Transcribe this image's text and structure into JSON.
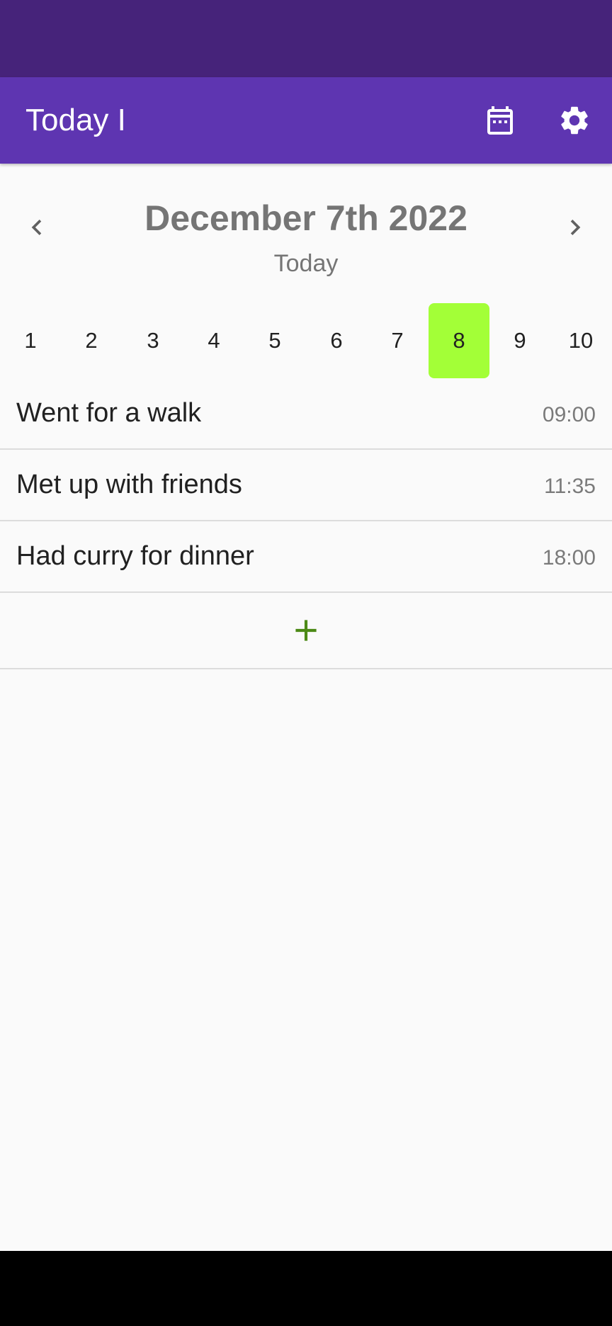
{
  "app": {
    "title": "Today I",
    "calendar_icon": "calendar-icon",
    "settings_icon": "gear-icon",
    "accent_color": "#5e35b1",
    "status_bar_color": "#46237a"
  },
  "date": {
    "title": "December 7th 2022",
    "subtitle": "Today",
    "prev_icon": "chevron-left-icon",
    "next_icon": "chevron-right-icon"
  },
  "days": {
    "items": [
      "1",
      "2",
      "3",
      "4",
      "5",
      "6",
      "7",
      "8",
      "9",
      "10"
    ],
    "selected": "8",
    "selected_color": "#a3ff37"
  },
  "entries": [
    {
      "text": "Went for a walk",
      "time": "09:00"
    },
    {
      "text": "Met up with friends",
      "time": "11:35"
    },
    {
      "text": "Had curry for dinner",
      "time": "18:00"
    }
  ],
  "add": {
    "icon": "plus-icon",
    "color": "#4c8a16"
  }
}
